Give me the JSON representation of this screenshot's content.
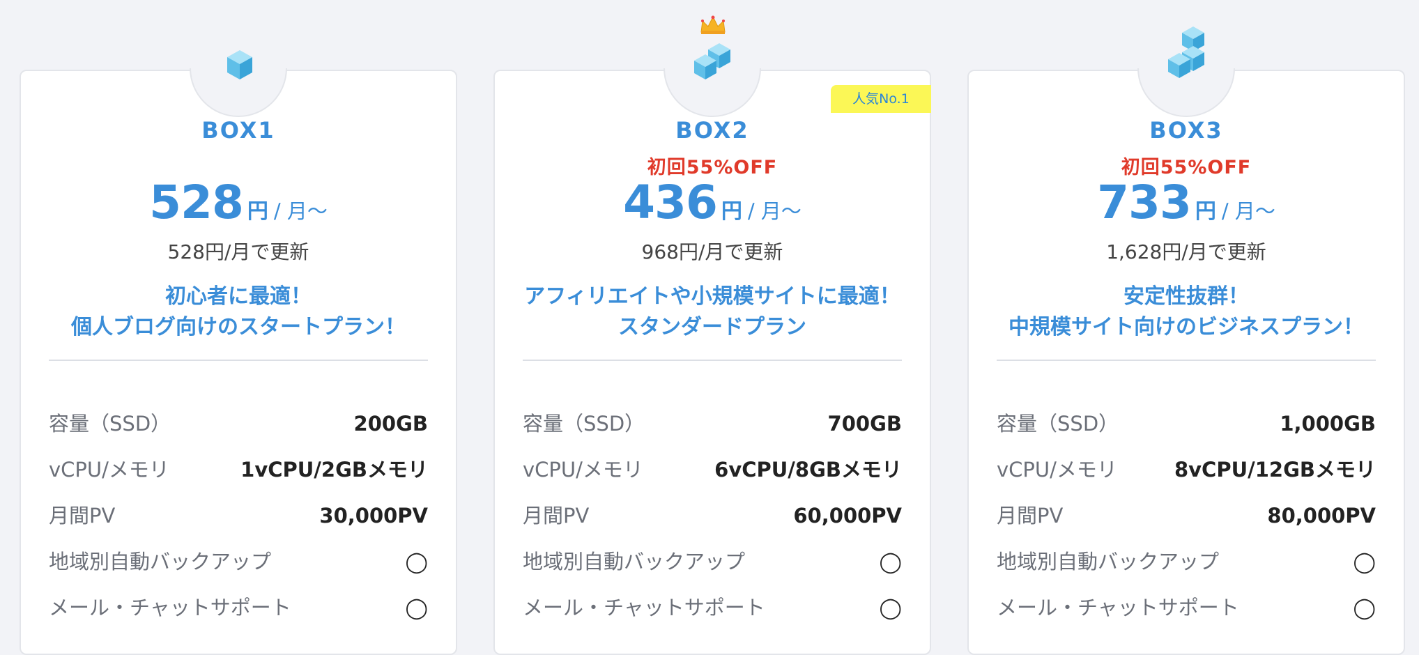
{
  "badge_label": "人気No.1",
  "spec_labels": [
    "容量（SSD）",
    "vCPU/メモリ",
    "月間PV",
    "地域別自動バックアップ",
    "メール・チャットサポート"
  ],
  "plans": [
    {
      "name": "BOX1",
      "discount": "",
      "price": "528",
      "yen": "円",
      "unit": "/ 月〜",
      "renew": "528円/月で更新",
      "catch_line1": "初心者に最適！",
      "catch_line2": "個人ブログ向けのスタートプラン！",
      "specs": [
        "200GB",
        "1vCPU/2GBメモリ",
        "30,000PV",
        "◯",
        "◯"
      ]
    },
    {
      "name": "BOX2",
      "discount": "初回55%OFF",
      "price": "436",
      "yen": "円",
      "unit": "/ 月〜",
      "renew": "968円/月で更新",
      "catch_line1": "アフィリエイトや小規模サイトに最適！",
      "catch_line2": "スタンダードプラン",
      "specs": [
        "700GB",
        "6vCPU/8GBメモリ",
        "60,000PV",
        "◯",
        "◯"
      ]
    },
    {
      "name": "BOX3",
      "discount": "初回55%OFF",
      "price": "733",
      "yen": "円",
      "unit": "/ 月〜",
      "renew": "1,628円/月で更新",
      "catch_line1": "安定性抜群！",
      "catch_line2": "中規模サイト向けのビジネスプラン！",
      "specs": [
        "1,000GB",
        "8vCPU/12GBメモリ",
        "80,000PV",
        "◯",
        "◯"
      ]
    }
  ],
  "colors": {
    "accent": "#3a8dd8",
    "discount": "#e03a2a",
    "badge_bg": "#fbf756",
    "cube": "#6cc6ec"
  },
  "icons": [
    "cube-icon",
    "cubes-icon",
    "crown-icon"
  ]
}
